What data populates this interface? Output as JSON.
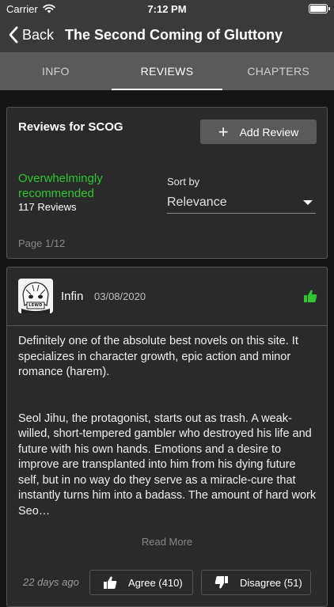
{
  "status": {
    "carrier": "Carrier",
    "time": "7:12 PM"
  },
  "nav": {
    "back_label": "Back",
    "title": "The Second Coming of Gluttony"
  },
  "tabs": [
    {
      "label": "INFO",
      "active": false
    },
    {
      "label": "REVIEWS",
      "active": true
    },
    {
      "label": "CHAPTERS",
      "active": false
    }
  ],
  "summary": {
    "title": "Reviews for SCOG",
    "add_review_label": "Add Review",
    "verdict": "Overwhelmingly recommended",
    "verdict_color": "#2fc62f",
    "review_count": "117 Reviews",
    "sort_label": "Sort by",
    "sort_value": "Relevance",
    "page": "Page 1/12"
  },
  "review": {
    "avatar_text": "LEWD",
    "name": "Infin",
    "date": "03/08/2020",
    "paragraphs": [
      "Definitely one of the absolute best novels on this site. It specializes in character growth, epic action and minor romance (harem).",
      "Seol Jihu, the protagonist, starts out as trash. A weak-willed, short-tempered gambler who destroyed his life and future with his own hands. Emotions and a desire to improve are transplanted into him from his dying future self, but in no way do they serve as a miracle-cure that instantly turns him into a badass. The amount of hard work Seo…"
    ],
    "read_more": "Read More",
    "posted_ago": "22 days ago",
    "agree_label": "Agree (410)",
    "disagree_label": "Disagree (51)"
  }
}
